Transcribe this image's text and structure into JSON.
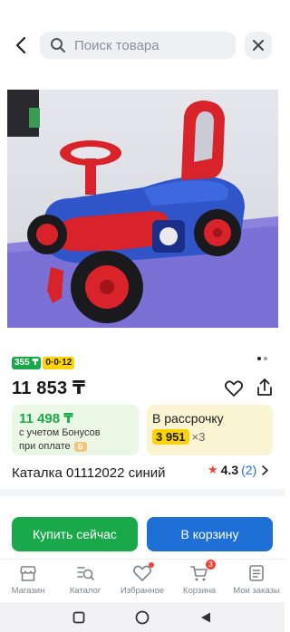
{
  "header": {
    "search_placeholder": "Поиск товара"
  },
  "product": {
    "badges": {
      "green": "355 ₸",
      "yellow": "0·0·12"
    },
    "price": "11 853 ₸",
    "bonus_card": {
      "amount": "11 498 ₸",
      "line1": "с учетом Бонусов",
      "line2": "при оплате",
      "icon_text": "Б"
    },
    "installment_card": {
      "title": "В рассрочку",
      "amount": "3 951",
      "multiplier": "×3"
    },
    "title": "Каталка 01112022 синий",
    "rating": {
      "value": "4.3",
      "count": "(2)"
    }
  },
  "actions": {
    "buy_now": "Купить сейчас",
    "add_to_cart": "В корзину"
  },
  "navbar": {
    "items": [
      {
        "label": "Магазин",
        "icon": "shop-icon"
      },
      {
        "label": "Каталог",
        "icon": "catalog-icon"
      },
      {
        "label": "Избранное",
        "icon": "heart-icon"
      },
      {
        "label": "Корзина",
        "icon": "cart-icon",
        "badge": "3"
      },
      {
        "label": "Мои заказы",
        "icon": "orders-icon"
      }
    ]
  },
  "colors": {
    "green": "#19a94a",
    "blue": "#1f70d6",
    "yellow": "#ffd200",
    "red": "#e9463c"
  }
}
